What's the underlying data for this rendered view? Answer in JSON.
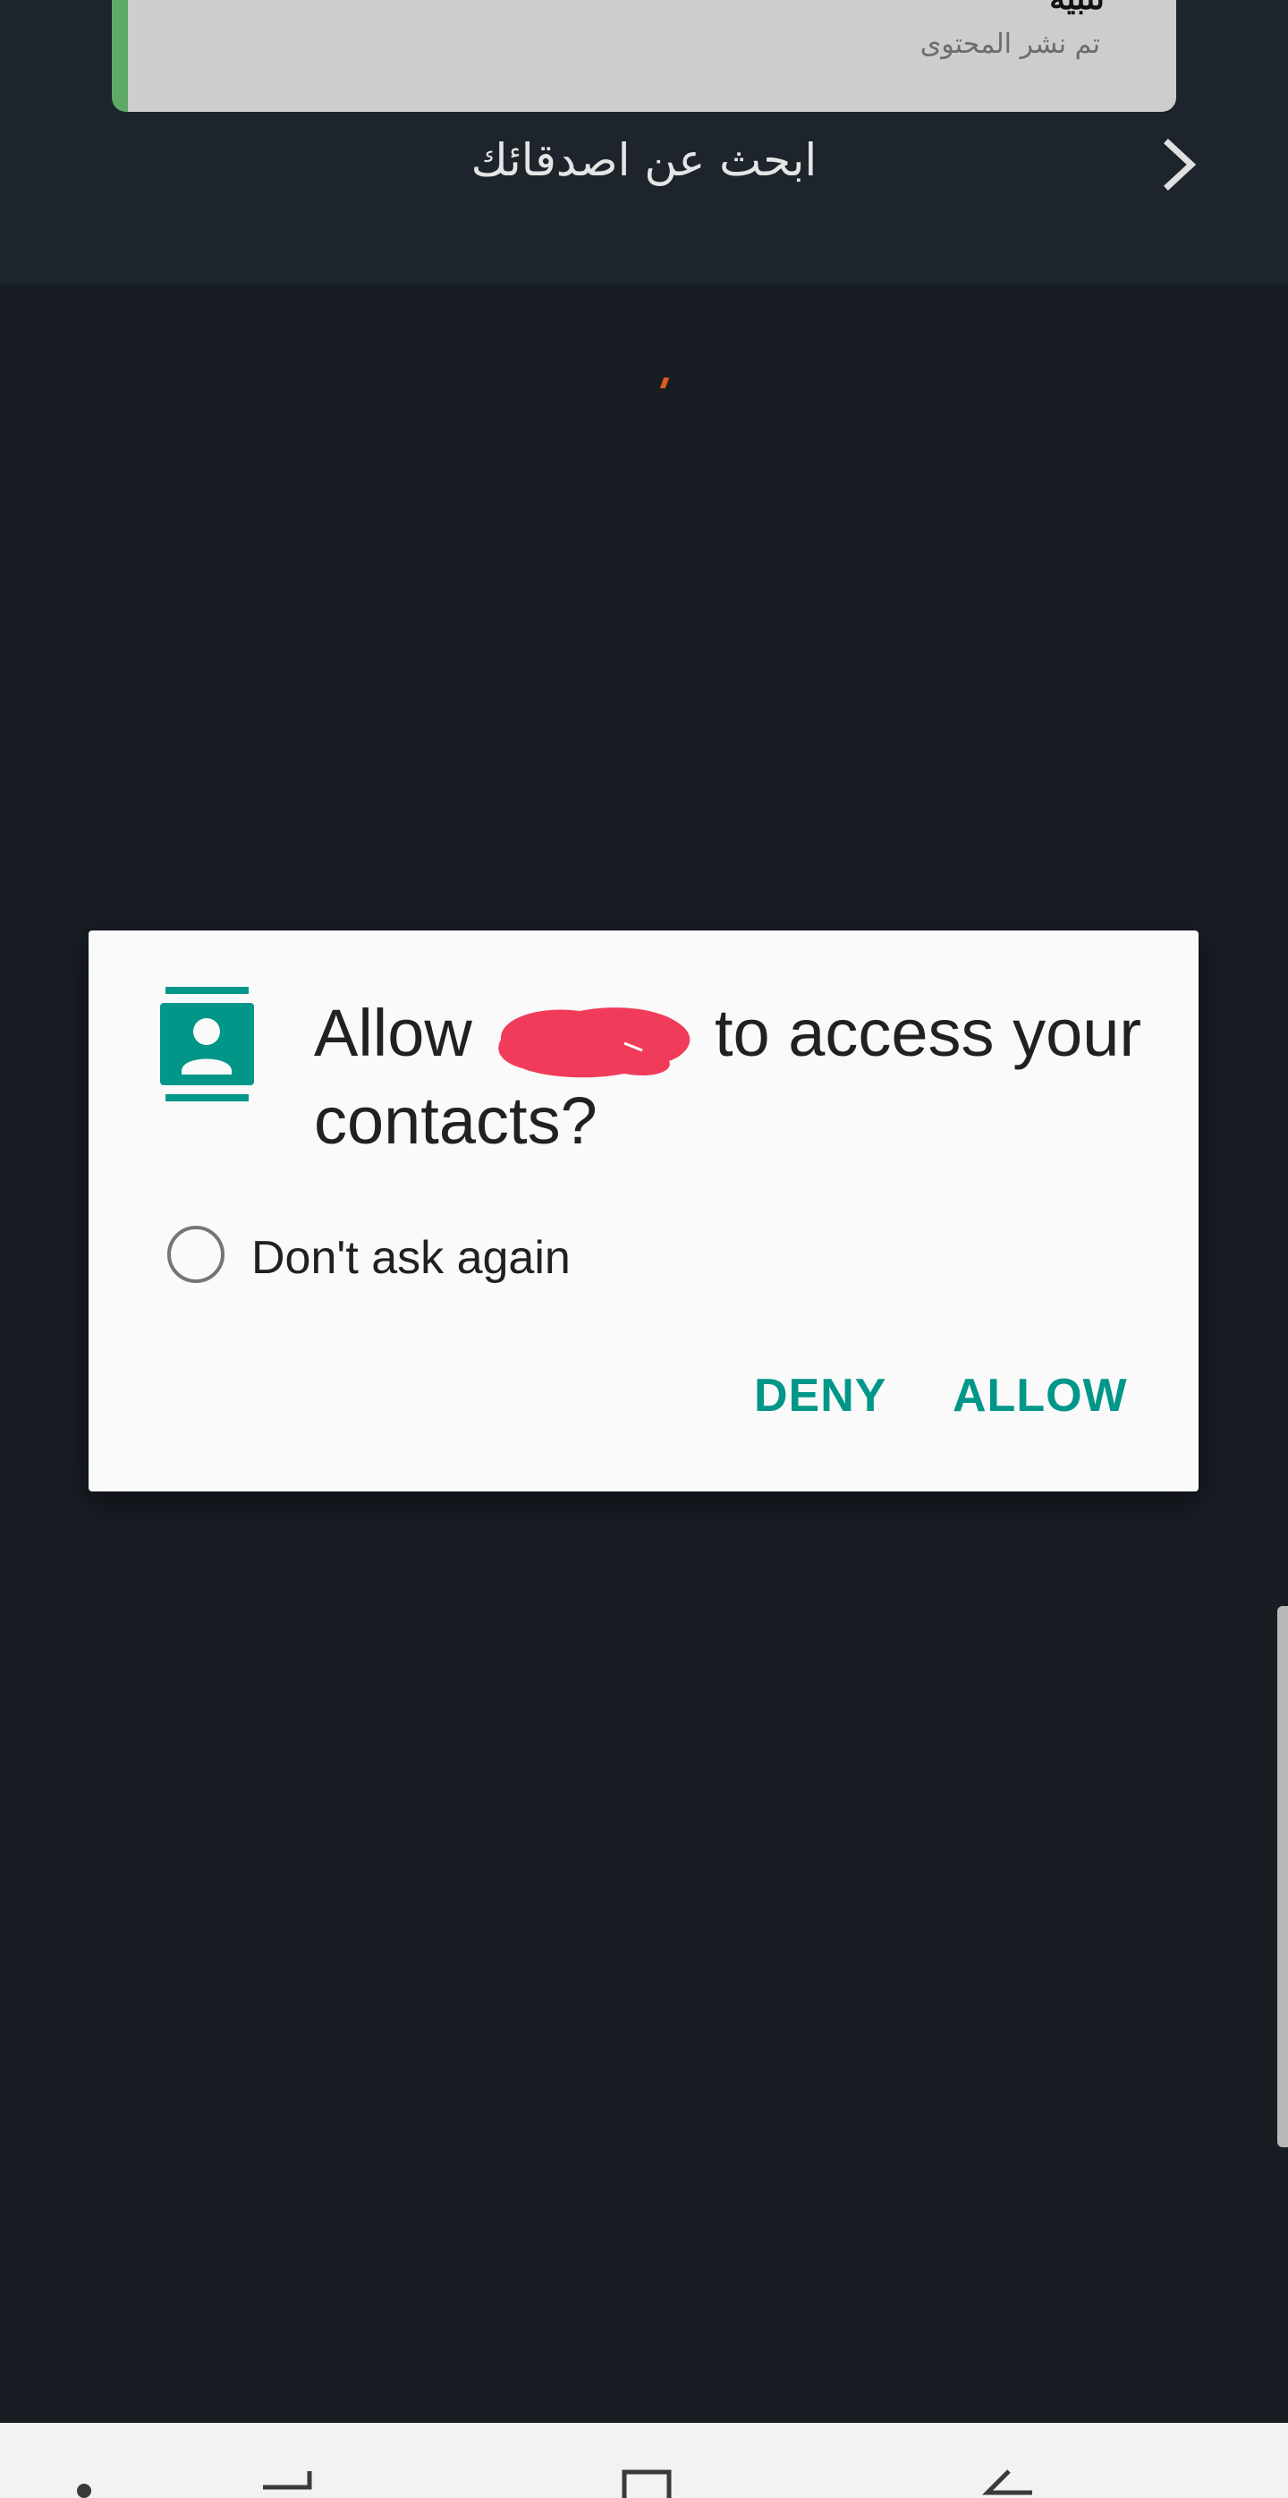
{
  "toast": {
    "title": "تنبيه",
    "subtitle": "تم نشر المحتوى",
    "accent_color": "#5faa67"
  },
  "find_friends": {
    "label": "ابحث عن اصدقائك",
    "icon": "chevron-right-icon"
  },
  "permission_dialog": {
    "icon": "contacts-icon",
    "title_prefix": "Allow",
    "title_suffix": "to access your contacts?",
    "dont_ask_label": "Don't ask again",
    "deny_label": "DENY",
    "allow_label": "ALLOW",
    "accent_color": "#009688"
  },
  "nav_bar": {
    "items": [
      "menu-dot-icon",
      "recent-apps-icon",
      "home-icon",
      "back-icon"
    ]
  }
}
